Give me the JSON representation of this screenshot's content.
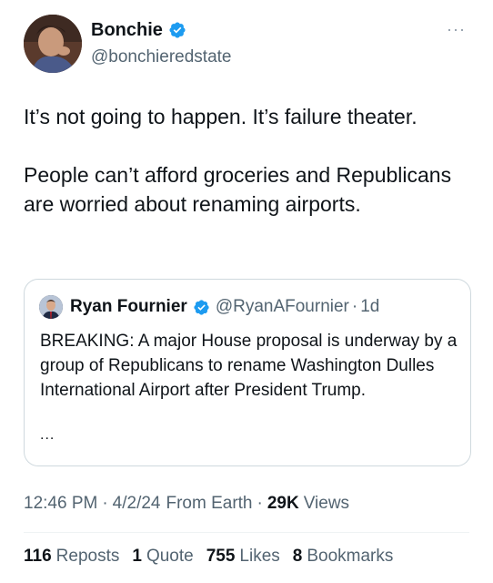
{
  "author": {
    "display_name": "Bonchie",
    "handle": "@bonchieredstate",
    "verified": true
  },
  "more_icon": "more-horizontal-icon",
  "tweet": {
    "paragraphs": [
      "It’s not going to happen. It’s failure theater.",
      "People can’t afford groceries and Republicans are worried about renaming airports."
    ]
  },
  "quote": {
    "display_name": "Ryan Fournier",
    "handle": "@RyanAFournier",
    "dot": "·",
    "time": "1d",
    "text": "BREAKING: A major House proposal is underway by a group of Republicans to rename Washington Dulles International Airport after President Trump.",
    "ellipsis": "..."
  },
  "meta": {
    "time": "12:46 PM",
    "sep1": "·",
    "date": "4/2/24",
    "source": "From Earth",
    "sep2": "·",
    "views_count": "29K",
    "views_label": "Views"
  },
  "stats": {
    "reposts": {
      "count": "116",
      "label": "Reposts"
    },
    "quotes": {
      "count": "1",
      "label": "Quote"
    },
    "likes": {
      "count": "755",
      "label": "Likes"
    },
    "bookmarks": {
      "count": "8",
      "label": "Bookmarks"
    }
  },
  "colors": {
    "verified_blue": "#1d9bf0",
    "text_primary": "#0f1419",
    "text_secondary": "#536471",
    "border": "#cfd9de"
  }
}
